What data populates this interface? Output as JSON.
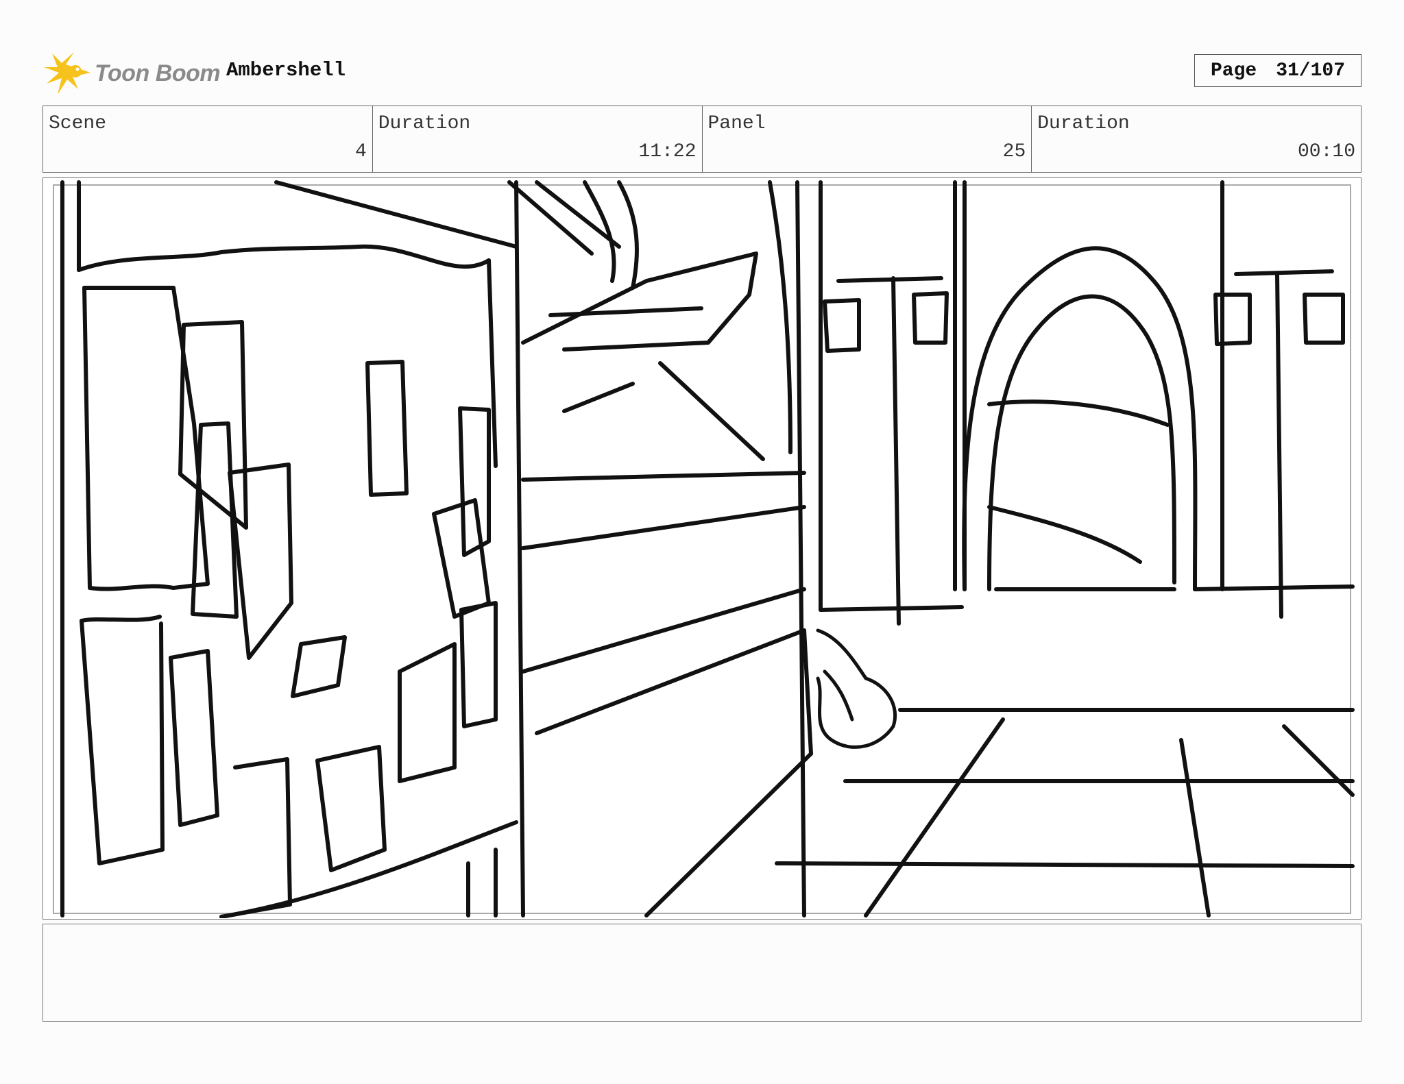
{
  "header": {
    "logo_text": "Toon Boom",
    "project_title": "Ambershell",
    "page_label": "Page",
    "page_value": "31/107"
  },
  "info": {
    "scene_label": "Scene",
    "scene_value": "4",
    "scene_duration_label": "Duration",
    "scene_duration_value": "11:22",
    "panel_label": "Panel",
    "panel_value": "25",
    "panel_duration_label": "Duration",
    "panel_duration_value": "00:10"
  },
  "notes": {
    "text": ""
  },
  "colors": {
    "logo_star": "#f6c21c",
    "logo_text": "#8a8a8a",
    "sketch_line": "#111111"
  }
}
